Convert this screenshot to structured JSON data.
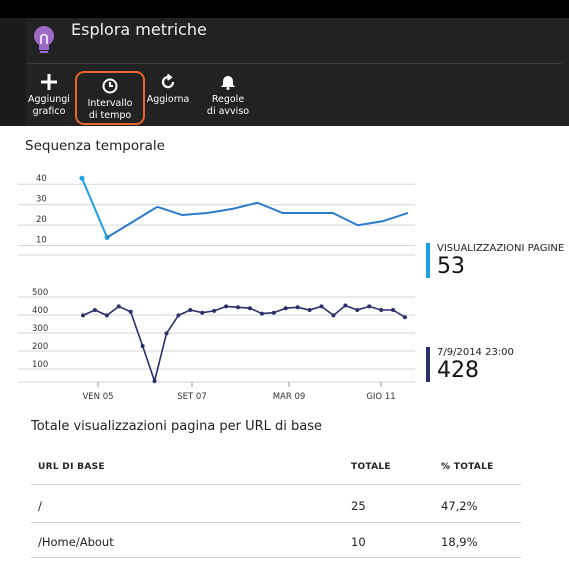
{
  "header": {
    "title": "Esplora metriche",
    "commands": [
      {
        "label": "Aggiungi\ngrafico",
        "icon": "plus-icon"
      },
      {
        "label": "Intervallo\ndi tempo",
        "icon": "clock-icon",
        "selected": true
      },
      {
        "label": "Aggiorna",
        "icon": "refresh-icon"
      },
      {
        "label": "Regole\ndi avviso",
        "icon": "bell-icon"
      }
    ]
  },
  "section_title": "Sequenza temporale",
  "chart_data": [
    {
      "type": "line",
      "y_ticks": [
        "40",
        "30",
        "20",
        "10"
      ],
      "ylim": [
        0,
        45
      ],
      "x": [
        0,
        1,
        2,
        3,
        4,
        5,
        6,
        7,
        8,
        9,
        10,
        11,
        12,
        13,
        14
      ],
      "series": [
        {
          "name": "VISUALIZZAZIONI PAGINE",
          "color": "#2a7cc9",
          "values": [
            40,
            11,
            null,
            26,
            22,
            23,
            25,
            28,
            23,
            23,
            23,
            17,
            19,
            23,
            null
          ]
        }
      ]
    },
    {
      "type": "line",
      "y_ticks": [
        "500",
        "400",
        "300",
        "200",
        "100"
      ],
      "ylim": [
        0,
        550
      ],
      "x_ticks": [
        "VEN 05",
        "SET 07",
        "MAR 09",
        "GIO 11"
      ],
      "series": [
        {
          "color": "#2b2f6b",
          "values": [
            370,
            400,
            370,
            420,
            390,
            200,
            5,
            270,
            370,
            400,
            385,
            395,
            420,
            415,
            410,
            380,
            385,
            410,
            415,
            400,
            420,
            370,
            425,
            400,
            420,
            400,
            400,
            360
          ]
        }
      ]
    }
  ],
  "summary1": {
    "label": "VISUALIZZAZIONI PAGINE",
    "value": "53",
    "color": "#1ba1e2"
  },
  "summary2": {
    "label": "7/9/2014 23:00",
    "value": "428",
    "color": "#2b2f6b"
  },
  "table": {
    "title": "Totale visualizzazioni pagina per URL di base",
    "headers": [
      "URL DI BASE",
      "TOTALE",
      "% TOTALE"
    ],
    "rows": [
      {
        "url": "/",
        "total": "25",
        "pct": "47,2%"
      },
      {
        "url": "/Home/About",
        "total": "10",
        "pct": "18,9%"
      }
    ]
  }
}
